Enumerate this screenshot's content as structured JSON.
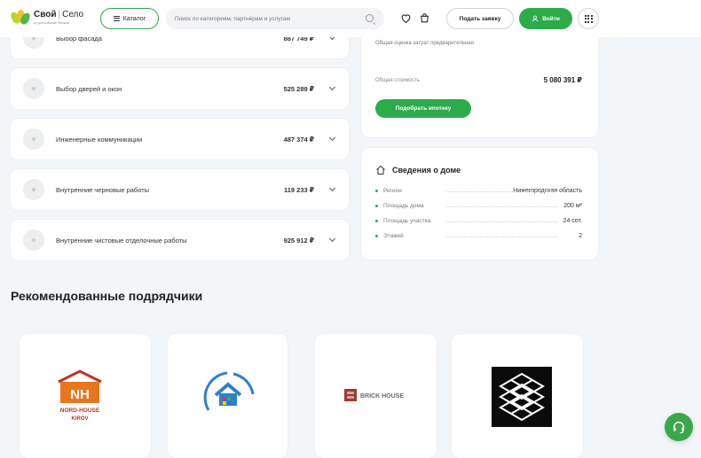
{
  "header": {
    "logo_title": "Свой",
    "logo_title2": "Село",
    "logo_sub": "от российских банков",
    "catalog_label": "Каталог",
    "search_placeholder": "Поиск по категориям, партнёрам и услугам",
    "request_label": "Подать заявку",
    "login_label": "Войти"
  },
  "cost_items": [
    {
      "name": "Выбор фасада",
      "price": "887 749 ₽"
    },
    {
      "name": "Выбор дверей и окон",
      "price": "525 289 ₽"
    },
    {
      "name": "Инженерные коммуникации",
      "price": "487 374 ₽"
    },
    {
      "name": "Внутренние черновые работы",
      "price": "119 233 ₽"
    },
    {
      "name": "Внутренние чистовые отделочные работы",
      "price": "925 912 ₽"
    }
  ],
  "mortgage": {
    "desc": "Общая оценка затрат предварительная",
    "total_label": "Общая стоимость",
    "total_value": "5 080 391 ₽",
    "button_label": "Подобрать ипотеку"
  },
  "house": {
    "title": "Сведения о доме",
    "rows": [
      {
        "label": "Регион",
        "value": "Нижегородская область"
      },
      {
        "label": "Площадь дома",
        "value": "200 м²"
      },
      {
        "label": "Площадь участка",
        "value": "24 сот."
      },
      {
        "label": "Этажей",
        "value": "2"
      }
    ]
  },
  "recommended": {
    "title": "Рекомендованные подрядчики",
    "partners": [
      {
        "logo_text": "NORD-HOUSE",
        "logo_sub": "KIROV"
      },
      {
        "logo_text": ""
      },
      {
        "logo_text": "BRICK HOUSE"
      },
      {
        "logo_text": ""
      }
    ]
  },
  "colors": {
    "accent": "#2cab4a",
    "nord_orange": "#e8761e",
    "nord_red": "#c4302b",
    "house_blue": "#2f7fd1"
  }
}
